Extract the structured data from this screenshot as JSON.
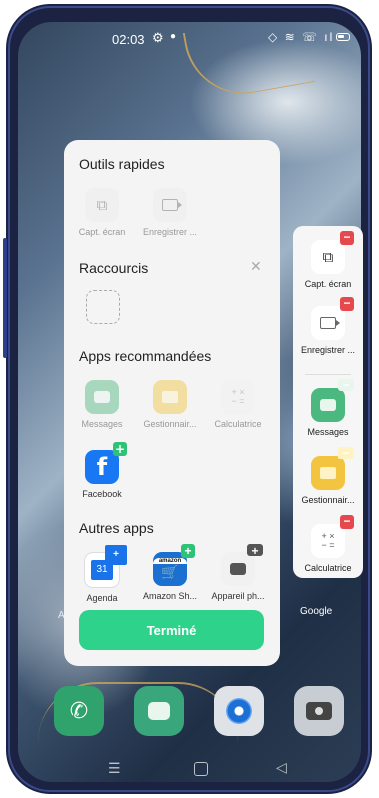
{
  "status": {
    "time": "02:03",
    "gear_icon": "⚙",
    "dot": "●",
    "signal_icons": "◇ ≋ ☏ ıl"
  },
  "wallpaper": {
    "colors": [
      "#33465e",
      "#9fb3c6",
      "#c9a45a"
    ]
  },
  "panel": {
    "quick_tools": {
      "title": "Outils rapides",
      "items": [
        {
          "label": "Capt. écran",
          "icon": "crop-icon"
        },
        {
          "label": "Enregistrer ...",
          "icon": "screen-record-icon"
        }
      ]
    },
    "shortcuts": {
      "title": "Raccourcis",
      "close": "✕"
    },
    "recommended": {
      "title": "Apps recommandées",
      "items": [
        {
          "label": "Messages",
          "icon": "messages-icon"
        },
        {
          "label": "Gestionnair...",
          "icon": "file-manager-icon"
        },
        {
          "label": "Calculatrice",
          "icon": "calculator-icon"
        },
        {
          "label": "Facebook",
          "icon": "facebook-icon"
        }
      ]
    },
    "other_apps": {
      "title": "Autres apps",
      "items": [
        {
          "label": "Agenda",
          "icon": "calendar-icon",
          "badge": "31"
        },
        {
          "label": "Amazon Sh...",
          "icon": "amazon-icon",
          "brand": "amazon"
        },
        {
          "label": "Appareil ph...",
          "icon": "camera-icon"
        }
      ]
    },
    "done_button": "Terminé",
    "add_symbol": "+",
    "facebook_letter": "f"
  },
  "strip": {
    "remove_symbol": "−",
    "items": [
      {
        "label": "Capt. écran",
        "icon": "crop-icon"
      },
      {
        "label": "Enregistrer ...",
        "icon": "screen-record-icon"
      },
      {
        "label": "Messages",
        "icon": "messages-icon"
      },
      {
        "label": "Gestionnair...",
        "icon": "file-manager-icon"
      },
      {
        "label": "Calculatrice",
        "icon": "calculator-icon"
      }
    ]
  },
  "home": {
    "google_label": "Google",
    "partial_label": "A"
  },
  "colors": {
    "accent_green": "#2fd28a",
    "remove_red": "#e5484d",
    "add_green": "#2ec276"
  }
}
